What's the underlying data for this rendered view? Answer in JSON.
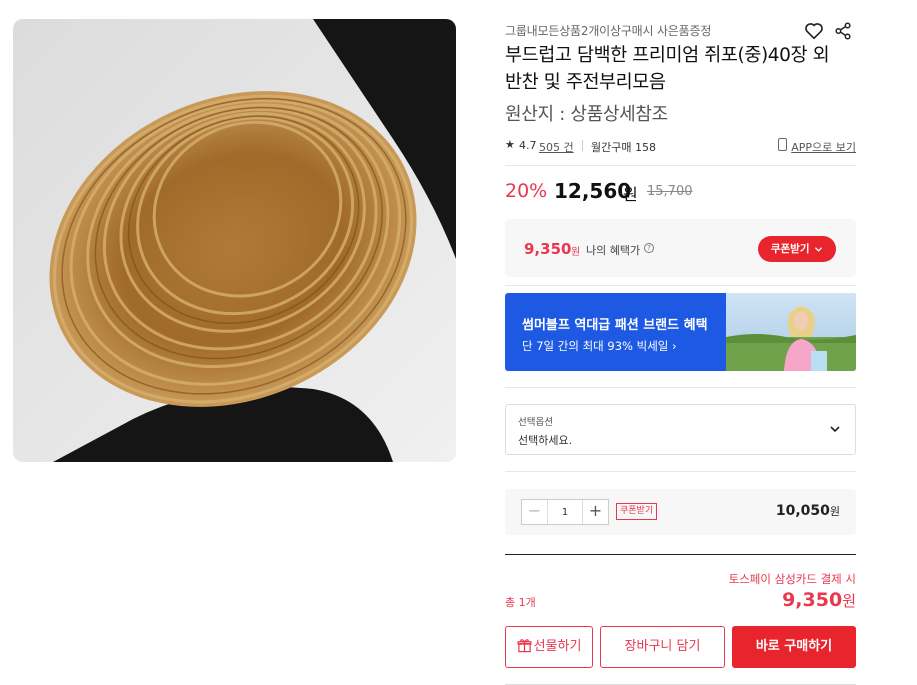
{
  "product": {
    "promo_text": "그룹내모든상품2개이상구매시 사은품증정",
    "title": "부드럽고 담백한 프리미엄 쥐포(중)40장 외 반찬 및 주전부리모음",
    "origin": "원산지 : 상품상세참조",
    "image_icon": "dried-filefish-photo"
  },
  "meta": {
    "rating": "4.7",
    "review_count": "505 건",
    "monthly_purchase": "월간구매 158",
    "app_link": "APP으로 보기"
  },
  "pricing": {
    "discount": "20%",
    "price": "12,560",
    "price_unit": "원",
    "original_price": "15,700"
  },
  "benefit": {
    "price": "9,350",
    "unit": "원",
    "label": "나의 혜택가",
    "coupon_button": "쿠폰받기"
  },
  "banner": {
    "title": "썸머블프 역대급 패션 브랜드 혜택",
    "subtitle": "단 7일 간의 최대 93% 빅세일 ›"
  },
  "option": {
    "label": "선택옵션",
    "placeholder": "선택하세요."
  },
  "quantity": {
    "minus": "−",
    "value": "1",
    "plus": "+",
    "coupon_tag": "쿠폰받기",
    "price": "10,050",
    "unit": "원"
  },
  "total": {
    "card_note": "토스페이 삼성카드 결제 시",
    "count": "총 1개",
    "price": "9,350",
    "unit": "원"
  },
  "buttons": {
    "gift": "선물하기",
    "cart": "장바구니 담기",
    "buy": "바로 구매하기"
  },
  "colors": {
    "accent": "#e8252d",
    "discount": "#e8384f",
    "banner": "#1d59e3"
  }
}
